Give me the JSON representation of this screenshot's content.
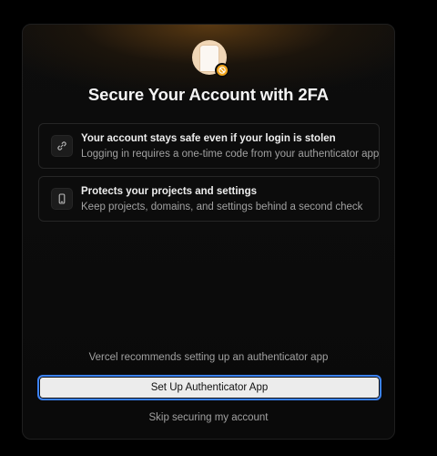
{
  "modal": {
    "title": "Secure Your Account with 2FA",
    "hero_icon": "document-with-badge-icon",
    "benefits": [
      {
        "icon": "link-icon",
        "heading": "Your account stays safe even if your login is stolen",
        "description": "Logging in requires a one-time code from your authenticator app"
      },
      {
        "icon": "mobile-phone-icon",
        "heading": "Protects your projects and settings",
        "description": "Keep projects, domains, and settings behind a second check"
      }
    ],
    "recommendation": "Vercel recommends setting up an authenticator app",
    "primary_button": "Set Up Authenticator App",
    "skip_link": "Skip securing my account"
  },
  "colors": {
    "background": "#000000",
    "modal_background": "#0a0a0a",
    "glow": "#965c16",
    "button_background": "#ececec",
    "button_focus_ring": "#3b82f6",
    "badge": "#f0a41c",
    "muted_text": "#a1a1a1"
  }
}
